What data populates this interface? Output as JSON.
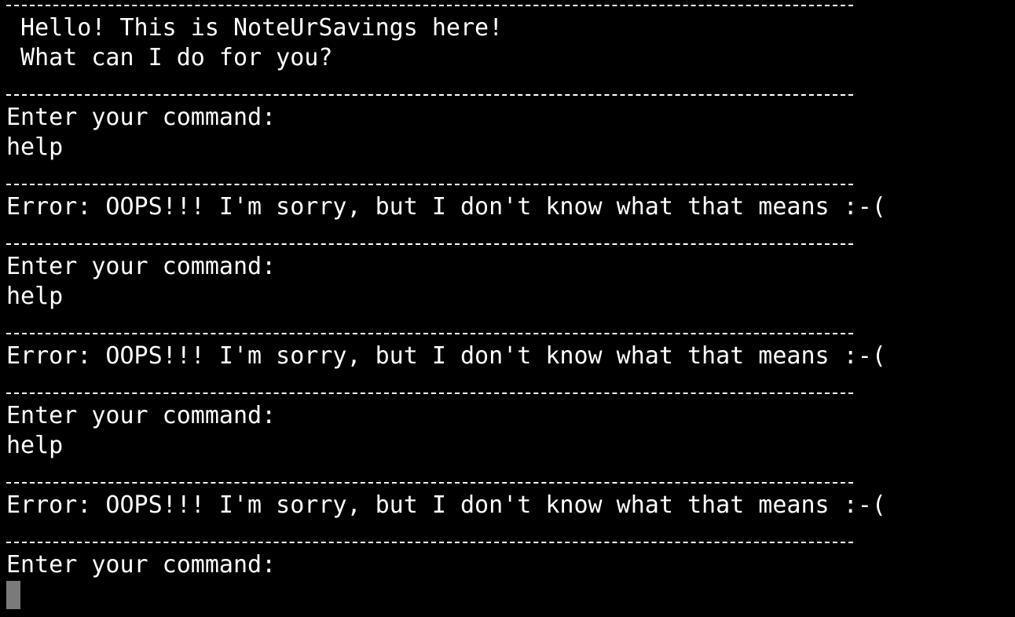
{
  "terminal": {
    "greeting_line1": " Hello! This is NoteUrSavings here!",
    "greeting_line2": " What can I do for you?",
    "prompt": "Enter your command:",
    "entries": [
      {
        "input": "help",
        "error": "Error: OOPS!!! I'm sorry, but I don't know what that means :-("
      },
      {
        "input": "help",
        "error": "Error: OOPS!!! I'm sorry, but I don't know what that means :-("
      },
      {
        "input": "help",
        "error": "Error: OOPS!!! I'm sorry, but I don't know what that means :-("
      }
    ],
    "cursor_icon": "block-cursor-icon"
  }
}
